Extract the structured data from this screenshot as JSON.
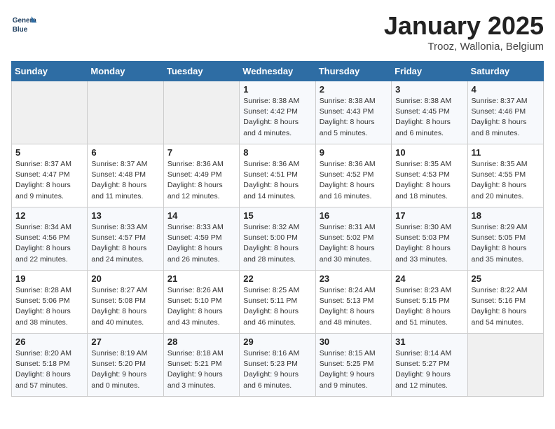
{
  "header": {
    "logo_line1": "General",
    "logo_line2": "Blue",
    "month_title": "January 2025",
    "subtitle": "Trooz, Wallonia, Belgium"
  },
  "weekdays": [
    "Sunday",
    "Monday",
    "Tuesday",
    "Wednesday",
    "Thursday",
    "Friday",
    "Saturday"
  ],
  "weeks": [
    [
      {
        "day": "",
        "sunrise": "",
        "sunset": "",
        "daylight": ""
      },
      {
        "day": "",
        "sunrise": "",
        "sunset": "",
        "daylight": ""
      },
      {
        "day": "",
        "sunrise": "",
        "sunset": "",
        "daylight": ""
      },
      {
        "day": "1",
        "sunrise": "Sunrise: 8:38 AM",
        "sunset": "Sunset: 4:42 PM",
        "daylight": "Daylight: 8 hours and 4 minutes."
      },
      {
        "day": "2",
        "sunrise": "Sunrise: 8:38 AM",
        "sunset": "Sunset: 4:43 PM",
        "daylight": "Daylight: 8 hours and 5 minutes."
      },
      {
        "day": "3",
        "sunrise": "Sunrise: 8:38 AM",
        "sunset": "Sunset: 4:45 PM",
        "daylight": "Daylight: 8 hours and 6 minutes."
      },
      {
        "day": "4",
        "sunrise": "Sunrise: 8:37 AM",
        "sunset": "Sunset: 4:46 PM",
        "daylight": "Daylight: 8 hours and 8 minutes."
      }
    ],
    [
      {
        "day": "5",
        "sunrise": "Sunrise: 8:37 AM",
        "sunset": "Sunset: 4:47 PM",
        "daylight": "Daylight: 8 hours and 9 minutes."
      },
      {
        "day": "6",
        "sunrise": "Sunrise: 8:37 AM",
        "sunset": "Sunset: 4:48 PM",
        "daylight": "Daylight: 8 hours and 11 minutes."
      },
      {
        "day": "7",
        "sunrise": "Sunrise: 8:36 AM",
        "sunset": "Sunset: 4:49 PM",
        "daylight": "Daylight: 8 hours and 12 minutes."
      },
      {
        "day": "8",
        "sunrise": "Sunrise: 8:36 AM",
        "sunset": "Sunset: 4:51 PM",
        "daylight": "Daylight: 8 hours and 14 minutes."
      },
      {
        "day": "9",
        "sunrise": "Sunrise: 8:36 AM",
        "sunset": "Sunset: 4:52 PM",
        "daylight": "Daylight: 8 hours and 16 minutes."
      },
      {
        "day": "10",
        "sunrise": "Sunrise: 8:35 AM",
        "sunset": "Sunset: 4:53 PM",
        "daylight": "Daylight: 8 hours and 18 minutes."
      },
      {
        "day": "11",
        "sunrise": "Sunrise: 8:35 AM",
        "sunset": "Sunset: 4:55 PM",
        "daylight": "Daylight: 8 hours and 20 minutes."
      }
    ],
    [
      {
        "day": "12",
        "sunrise": "Sunrise: 8:34 AM",
        "sunset": "Sunset: 4:56 PM",
        "daylight": "Daylight: 8 hours and 22 minutes."
      },
      {
        "day": "13",
        "sunrise": "Sunrise: 8:33 AM",
        "sunset": "Sunset: 4:57 PM",
        "daylight": "Daylight: 8 hours and 24 minutes."
      },
      {
        "day": "14",
        "sunrise": "Sunrise: 8:33 AM",
        "sunset": "Sunset: 4:59 PM",
        "daylight": "Daylight: 8 hours and 26 minutes."
      },
      {
        "day": "15",
        "sunrise": "Sunrise: 8:32 AM",
        "sunset": "Sunset: 5:00 PM",
        "daylight": "Daylight: 8 hours and 28 minutes."
      },
      {
        "day": "16",
        "sunrise": "Sunrise: 8:31 AM",
        "sunset": "Sunset: 5:02 PM",
        "daylight": "Daylight: 8 hours and 30 minutes."
      },
      {
        "day": "17",
        "sunrise": "Sunrise: 8:30 AM",
        "sunset": "Sunset: 5:03 PM",
        "daylight": "Daylight: 8 hours and 33 minutes."
      },
      {
        "day": "18",
        "sunrise": "Sunrise: 8:29 AM",
        "sunset": "Sunset: 5:05 PM",
        "daylight": "Daylight: 8 hours and 35 minutes."
      }
    ],
    [
      {
        "day": "19",
        "sunrise": "Sunrise: 8:28 AM",
        "sunset": "Sunset: 5:06 PM",
        "daylight": "Daylight: 8 hours and 38 minutes."
      },
      {
        "day": "20",
        "sunrise": "Sunrise: 8:27 AM",
        "sunset": "Sunset: 5:08 PM",
        "daylight": "Daylight: 8 hours and 40 minutes."
      },
      {
        "day": "21",
        "sunrise": "Sunrise: 8:26 AM",
        "sunset": "Sunset: 5:10 PM",
        "daylight": "Daylight: 8 hours and 43 minutes."
      },
      {
        "day": "22",
        "sunrise": "Sunrise: 8:25 AM",
        "sunset": "Sunset: 5:11 PM",
        "daylight": "Daylight: 8 hours and 46 minutes."
      },
      {
        "day": "23",
        "sunrise": "Sunrise: 8:24 AM",
        "sunset": "Sunset: 5:13 PM",
        "daylight": "Daylight: 8 hours and 48 minutes."
      },
      {
        "day": "24",
        "sunrise": "Sunrise: 8:23 AM",
        "sunset": "Sunset: 5:15 PM",
        "daylight": "Daylight: 8 hours and 51 minutes."
      },
      {
        "day": "25",
        "sunrise": "Sunrise: 8:22 AM",
        "sunset": "Sunset: 5:16 PM",
        "daylight": "Daylight: 8 hours and 54 minutes."
      }
    ],
    [
      {
        "day": "26",
        "sunrise": "Sunrise: 8:20 AM",
        "sunset": "Sunset: 5:18 PM",
        "daylight": "Daylight: 8 hours and 57 minutes."
      },
      {
        "day": "27",
        "sunrise": "Sunrise: 8:19 AM",
        "sunset": "Sunset: 5:20 PM",
        "daylight": "Daylight: 9 hours and 0 minutes."
      },
      {
        "day": "28",
        "sunrise": "Sunrise: 8:18 AM",
        "sunset": "Sunset: 5:21 PM",
        "daylight": "Daylight: 9 hours and 3 minutes."
      },
      {
        "day": "29",
        "sunrise": "Sunrise: 8:16 AM",
        "sunset": "Sunset: 5:23 PM",
        "daylight": "Daylight: 9 hours and 6 minutes."
      },
      {
        "day": "30",
        "sunrise": "Sunrise: 8:15 AM",
        "sunset": "Sunset: 5:25 PM",
        "daylight": "Daylight: 9 hours and 9 minutes."
      },
      {
        "day": "31",
        "sunrise": "Sunrise: 8:14 AM",
        "sunset": "Sunset: 5:27 PM",
        "daylight": "Daylight: 9 hours and 12 minutes."
      },
      {
        "day": "",
        "sunrise": "",
        "sunset": "",
        "daylight": ""
      }
    ]
  ]
}
